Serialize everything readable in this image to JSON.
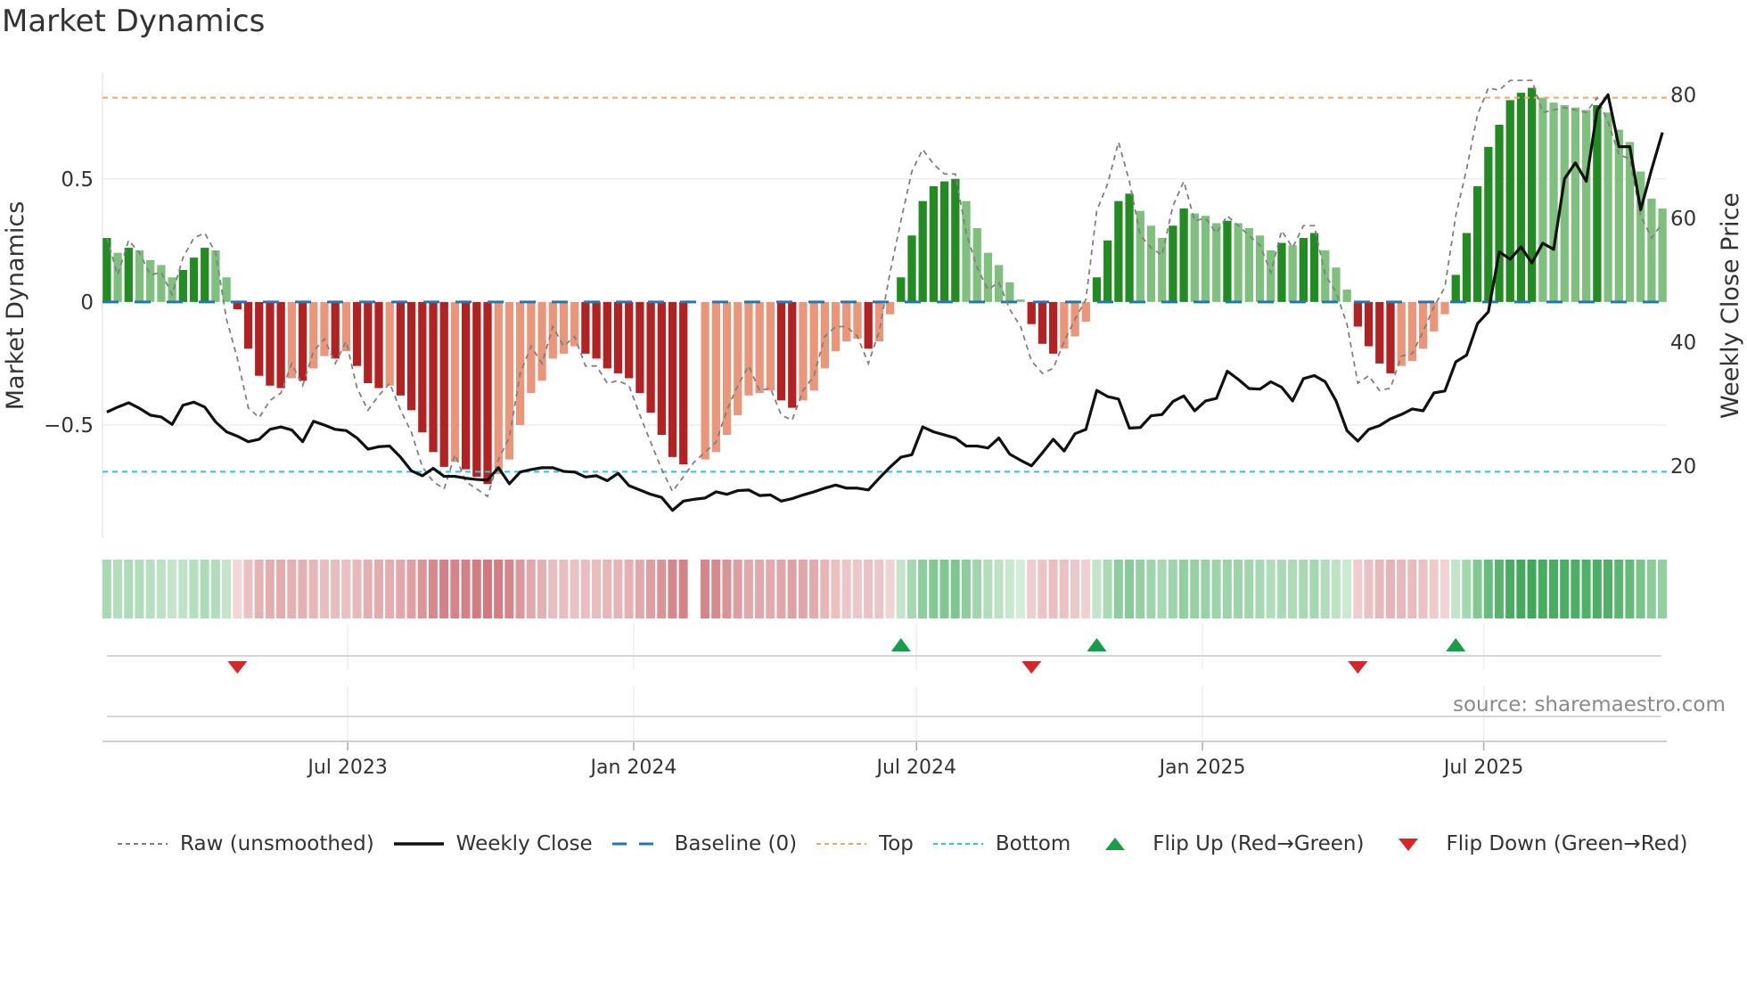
{
  "chart_data": {
    "type": "bar",
    "title": "Market Dynamics",
    "ylabel": "Market Dynamics",
    "y2label": "Weekly Close Price",
    "ylim": [
      -0.96,
      0.93
    ],
    "y2lim": [
      8.3,
      83.5
    ],
    "yticks": [
      {
        "v": 0.5,
        "label": "0.5"
      },
      {
        "v": 0,
        "label": "0"
      },
      {
        "v": -0.5,
        "label": "−0.5"
      }
    ],
    "y2ticks": [
      {
        "v": 80,
        "label": "80"
      },
      {
        "v": 60,
        "label": "60"
      },
      {
        "v": 40,
        "label": "40"
      },
      {
        "v": 20,
        "label": "20"
      }
    ],
    "xticks": [
      {
        "date": "2023-07-01",
        "label": "Jul 2023"
      },
      {
        "date": "2024-01-01",
        "label": "Jan 2024"
      },
      {
        "date": "2024-07-01",
        "label": "Jul 2024"
      },
      {
        "date": "2025-01-01",
        "label": "Jan 2025"
      },
      {
        "date": "2025-07-01",
        "label": "Jul 2025"
      }
    ],
    "x_start": "2023-01-27",
    "x_freq_days": 7,
    "top_level": 0.83,
    "bottom_level": -0.69,
    "baseline": 0,
    "dynamics": [
      0.26,
      0.2,
      0.22,
      0.21,
      0.17,
      0.15,
      0.1,
      0.13,
      0.18,
      0.22,
      0.21,
      0.1,
      -0.03,
      -0.19,
      -0.3,
      -0.34,
      -0.35,
      -0.31,
      -0.32,
      -0.27,
      -0.22,
      -0.23,
      -0.2,
      -0.26,
      -0.33,
      -0.35,
      -0.34,
      -0.38,
      -0.44,
      -0.53,
      -0.61,
      -0.67,
      -0.65,
      -0.68,
      -0.71,
      -0.74,
      -0.7,
      -0.64,
      -0.5,
      -0.37,
      -0.32,
      -0.23,
      -0.21,
      -0.18,
      -0.21,
      -0.23,
      -0.27,
      -0.29,
      -0.31,
      -0.37,
      -0.45,
      -0.54,
      -0.63,
      -0.66,
      null,
      -0.64,
      -0.61,
      -0.54,
      -0.46,
      -0.38,
      -0.37,
      -0.36,
      -0.4,
      -0.43,
      -0.4,
      -0.36,
      -0.27,
      -0.2,
      -0.16,
      -0.15,
      -0.19,
      -0.16,
      -0.05,
      0.1,
      0.27,
      0.41,
      0.47,
      0.49,
      0.5,
      0.41,
      0.3,
      0.2,
      0.15,
      0.08,
      0.01,
      -0.09,
      -0.17,
      -0.21,
      -0.19,
      -0.14,
      -0.08,
      0.1,
      0.25,
      0.41,
      0.44,
      0.37,
      0.31,
      0.26,
      0.31,
      0.38,
      0.36,
      0.35,
      0.32,
      0.33,
      0.32,
      0.3,
      0.27,
      0.21,
      0.24,
      0.23,
      0.26,
      0.28,
      0.21,
      0.14,
      0.05,
      -0.1,
      -0.18,
      -0.25,
      -0.29,
      -0.26,
      -0.24,
      -0.19,
      -0.12,
      -0.05,
      0.11,
      0.28,
      0.47,
      0.63,
      0.72,
      0.82,
      0.85,
      0.87,
      0.83,
      0.81,
      0.8,
      0.79,
      0.78,
      0.8,
      0.77,
      0.7,
      0.65,
      0.53,
      0.42,
      0.38
    ],
    "raw": [
      0.26,
      0.11,
      0.25,
      0.2,
      0.11,
      0.12,
      0.03,
      0.18,
      0.26,
      0.28,
      0.2,
      -0.07,
      -0.23,
      -0.43,
      -0.47,
      -0.4,
      -0.37,
      -0.25,
      -0.34,
      -0.2,
      -0.15,
      -0.25,
      -0.16,
      -0.35,
      -0.44,
      -0.38,
      -0.33,
      -0.44,
      -0.53,
      -0.67,
      -0.73,
      -0.76,
      -0.62,
      -0.73,
      -0.76,
      -0.79,
      -0.64,
      -0.55,
      -0.29,
      -0.18,
      -0.25,
      -0.1,
      -0.18,
      -0.14,
      -0.26,
      -0.26,
      -0.33,
      -0.32,
      -0.34,
      -0.46,
      -0.57,
      -0.68,
      -0.77,
      -0.71,
      -0.65,
      -0.61,
      -0.57,
      -0.44,
      -0.34,
      -0.26,
      -0.36,
      -0.35,
      -0.46,
      -0.48,
      -0.36,
      -0.3,
      -0.14,
      -0.1,
      -0.1,
      -0.14,
      -0.25,
      -0.12,
      0.12,
      0.33,
      0.53,
      0.62,
      0.56,
      0.52,
      0.52,
      0.28,
      0.14,
      0.05,
      0.08,
      -0.03,
      -0.1,
      -0.24,
      -0.29,
      -0.27,
      -0.16,
      -0.07,
      0.01,
      0.37,
      0.48,
      0.65,
      0.49,
      0.27,
      0.22,
      0.19,
      0.39,
      0.49,
      0.33,
      0.34,
      0.28,
      0.35,
      0.31,
      0.27,
      0.23,
      0.12,
      0.29,
      0.22,
      0.31,
      0.31,
      0.11,
      0.04,
      -0.09,
      -0.33,
      -0.3,
      -0.36,
      -0.35,
      -0.22,
      -0.21,
      -0.12,
      -0.02,
      0.06,
      0.35,
      0.54,
      0.76,
      0.87,
      0.86,
      0.9,
      0.9,
      0.9,
      0.77,
      0.78,
      0.79,
      0.78,
      0.77,
      0.83,
      0.73,
      0.6,
      0.58,
      0.35,
      0.26,
      0.32
    ],
    "weekly_close": [
      28.7,
      29.5,
      30.2,
      29.3,
      28.2,
      27.9,
      26.7,
      29.8,
      30.3,
      29.5,
      27.1,
      25.5,
      24.8,
      23.9,
      24.3,
      25.9,
      26.3,
      25.8,
      23.9,
      27.2,
      26.6,
      25.9,
      25.7,
      24.5,
      22.7,
      23.1,
      23.2,
      21.4,
      19.2,
      18.4,
      19.6,
      18.3,
      18.3,
      18.0,
      17.8,
      17.7,
      19.7,
      17.1,
      19.0,
      19.4,
      19.7,
      19.7,
      19.1,
      19.0,
      18.2,
      18.4,
      17.6,
      18.8,
      16.8,
      16.1,
      15.4,
      14.9,
      12.8,
      14.3,
      14.6,
      14.8,
      15.8,
      15.4,
      16.0,
      16.1,
      15.2,
      15.3,
      14.3,
      14.7,
      15.3,
      15.8,
      16.4,
      16.9,
      16.4,
      16.4,
      16.1,
      18.0,
      19.8,
      21.4,
      21.8,
      26.3,
      25.5,
      25.0,
      24.5,
      23.2,
      23.2,
      22.9,
      24.5,
      21.9,
      20.9,
      20.0,
      22.1,
      24.3,
      22.4,
      25.2,
      25.9,
      32.2,
      31.2,
      30.8,
      26.1,
      26.2,
      28.1,
      28.3,
      30.4,
      31.3,
      28.9,
      30.5,
      30.9,
      35.3,
      34.0,
      32.5,
      32.4,
      33.6,
      32.7,
      30.5,
      34.1,
      34.6,
      33.6,
      30.5,
      25.7,
      24.0,
      25.9,
      26.5,
      27.6,
      28.3,
      29.2,
      28.9,
      31.8,
      32.1,
      36.8,
      37.9,
      43.0,
      44.9,
      54.6,
      53.4,
      55.4,
      52.8,
      56.0,
      55.0,
      66.4,
      69.0,
      66.0,
      77.5,
      80.0,
      71.6,
      71.6,
      61.4,
      67.9,
      73.9
    ],
    "colors": {
      "green_strong": "#228b22",
      "green_weak": "#7fc07f",
      "red_strong": "#b22222",
      "red_weak": "#e9967a",
      "heat_green_lo": "#d4eed9",
      "heat_green_hi": "#3aa655",
      "heat_red_lo": "#f4dada",
      "heat_red_hi": "#c9646a",
      "raw": "#808080",
      "close": "#111111",
      "baseline": "#1f77b4",
      "top": "#f0a868",
      "bottom": "#2ec4d6",
      "flip_up": "#1a9c4a",
      "flip_down": "#d62728"
    },
    "legend": {
      "placement": "bottom",
      "items": [
        {
          "key": "raw",
          "label": "Raw (unsmoothed)"
        },
        {
          "key": "close",
          "label": "Weekly Close"
        },
        {
          "key": "baseline",
          "label": "Baseline (0)"
        },
        {
          "key": "top",
          "label": "Top"
        },
        {
          "key": "bottom",
          "label": "Bottom"
        },
        {
          "key": "flip_up",
          "label": "Flip Up (Red→Green)"
        },
        {
          "key": "flip_down",
          "label": "Flip Down (Green→Red)"
        }
      ]
    },
    "source": "source: sharemaestro.com"
  }
}
